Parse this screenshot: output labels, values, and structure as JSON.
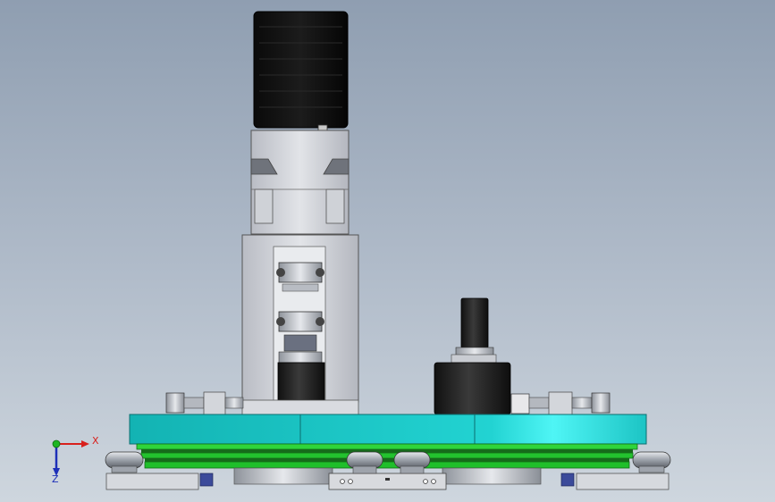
{
  "triad": {
    "x_label": "X",
    "z_label": "Z"
  },
  "colors": {
    "background_top": "#8f9eb1",
    "background_bottom": "#ced6de",
    "motor": "#0c0c0c",
    "housing": "#d4d6dc",
    "teal_plate": "#14c5c4",
    "green_belt": "#1fbf2a",
    "axis_x": "#d8201c",
    "axis_y": "#1db523",
    "axis_z": "#1d2fb8"
  }
}
